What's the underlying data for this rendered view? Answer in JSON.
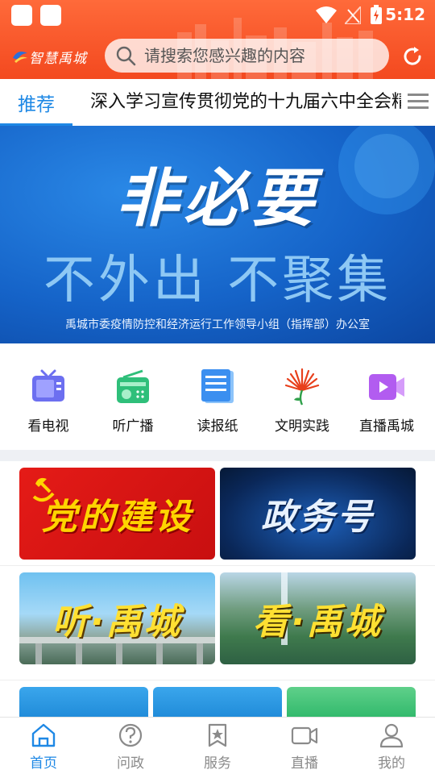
{
  "status_bar": {
    "time": "5:12"
  },
  "header": {
    "logo_text": "智慧禹城",
    "search_placeholder": "请搜索您感兴趣的内容",
    "refresh_icon": "refresh-icon"
  },
  "tabs": {
    "active": "推荐",
    "headline": "深入学习宣传贯彻党的十九届六中全会精神"
  },
  "banner": {
    "title": "非必要",
    "subtitle": "不外出  不聚集",
    "footer": "禹城市委疫情防控和经济运行工作领导小组（指挥部）办公室"
  },
  "quick_links": [
    {
      "label": "看电视",
      "icon": "tv-icon",
      "color": "#6c6ff0"
    },
    {
      "label": "听广播",
      "icon": "radio-icon",
      "color": "#2fbf7a"
    },
    {
      "label": "读报纸",
      "icon": "newspaper-icon",
      "color": "#3b8ff0"
    },
    {
      "label": "文明实践",
      "icon": "civilization-icon",
      "color": "#e8401c"
    },
    {
      "label": "直播禹城",
      "icon": "video-camera-icon",
      "color": "#b25cf0"
    }
  ],
  "cards": [
    {
      "label": "党的建设"
    },
    {
      "label": "政务号"
    },
    {
      "label": "听·禹城"
    },
    {
      "label": "看·禹城"
    }
  ],
  "bottom_nav": [
    {
      "label": "首页",
      "icon": "home-icon"
    },
    {
      "label": "问政",
      "icon": "question-icon"
    },
    {
      "label": "服务",
      "icon": "service-star-icon"
    },
    {
      "label": "直播",
      "icon": "live-camera-icon"
    },
    {
      "label": "我的",
      "icon": "user-icon"
    }
  ],
  "colors": {
    "header": "#f3491f",
    "accent": "#1e88e5",
    "banner": "#1563c8"
  }
}
